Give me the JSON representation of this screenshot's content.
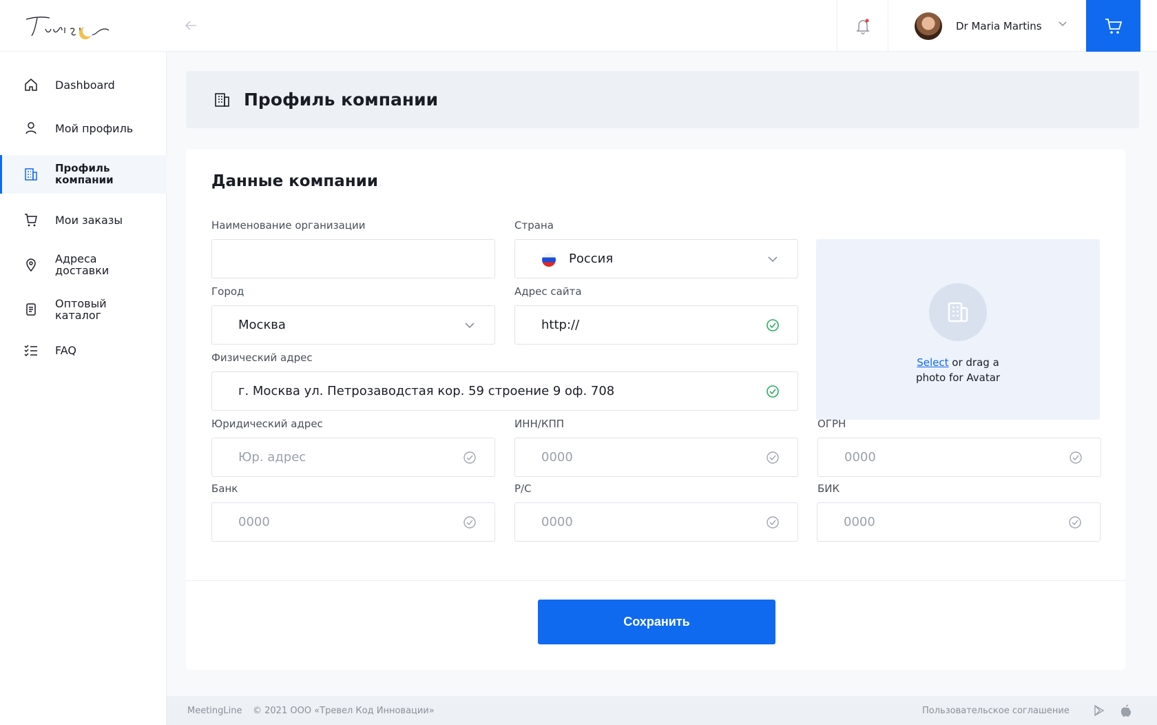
{
  "header": {
    "user_name": "Dr Maria Martins"
  },
  "sidebar": {
    "items": [
      {
        "label": "Dashboard",
        "icon": "home-icon"
      },
      {
        "label": "Мой профиль",
        "icon": "user-icon"
      },
      {
        "label": "Профиль\nкомпании",
        "icon": "building-icon",
        "active": true
      },
      {
        "label": "Мои заказы",
        "icon": "cart-icon"
      },
      {
        "label": "Адреса\nдоставки",
        "icon": "location-pin-icon"
      },
      {
        "label": "Оптовый\nкаталог",
        "icon": "document-icon"
      },
      {
        "label": "FAQ",
        "icon": "checklist-icon"
      }
    ]
  },
  "page": {
    "title": "Профиль компании",
    "card_title": "Данные компании"
  },
  "form": {
    "org_name": {
      "label": "Наименование организации",
      "value": ""
    },
    "country": {
      "label": "Страна",
      "value": "Россия"
    },
    "city": {
      "label": "Город",
      "value": "Москва"
    },
    "website": {
      "label": "Адрес сайта",
      "value": "http://"
    },
    "physical_address": {
      "label": "Физический адрес",
      "value": "г. Москва ул. Петрозаводстая кор. 59 строение 9 оф. 708"
    },
    "legal_address": {
      "label": "Юридический адрес",
      "placeholder": "Юр. адрес"
    },
    "inn": {
      "label": "ИНН/КПП",
      "placeholder": "0000"
    },
    "ogrn": {
      "label": "ОГРН",
      "placeholder": "0000"
    },
    "bank": {
      "label": "Банк",
      "placeholder": "0000"
    },
    "rs": {
      "label": "Р/С",
      "placeholder": "0000"
    },
    "bik": {
      "label": "БИК",
      "placeholder": "0000"
    }
  },
  "upload": {
    "link": "Select",
    "text1": " or drag a",
    "text2": "photo for Avatar"
  },
  "save_label": "Сохранить",
  "footer": {
    "brand": "MeetingLine",
    "copyright": "© 2021 ООО «Тревел Код Инновации»",
    "agreement": "Пользовательское соглашение"
  },
  "colors": {
    "accent": "#0f6af0",
    "valid": "#27ae60",
    "muted_check": "#a0a6ae"
  }
}
